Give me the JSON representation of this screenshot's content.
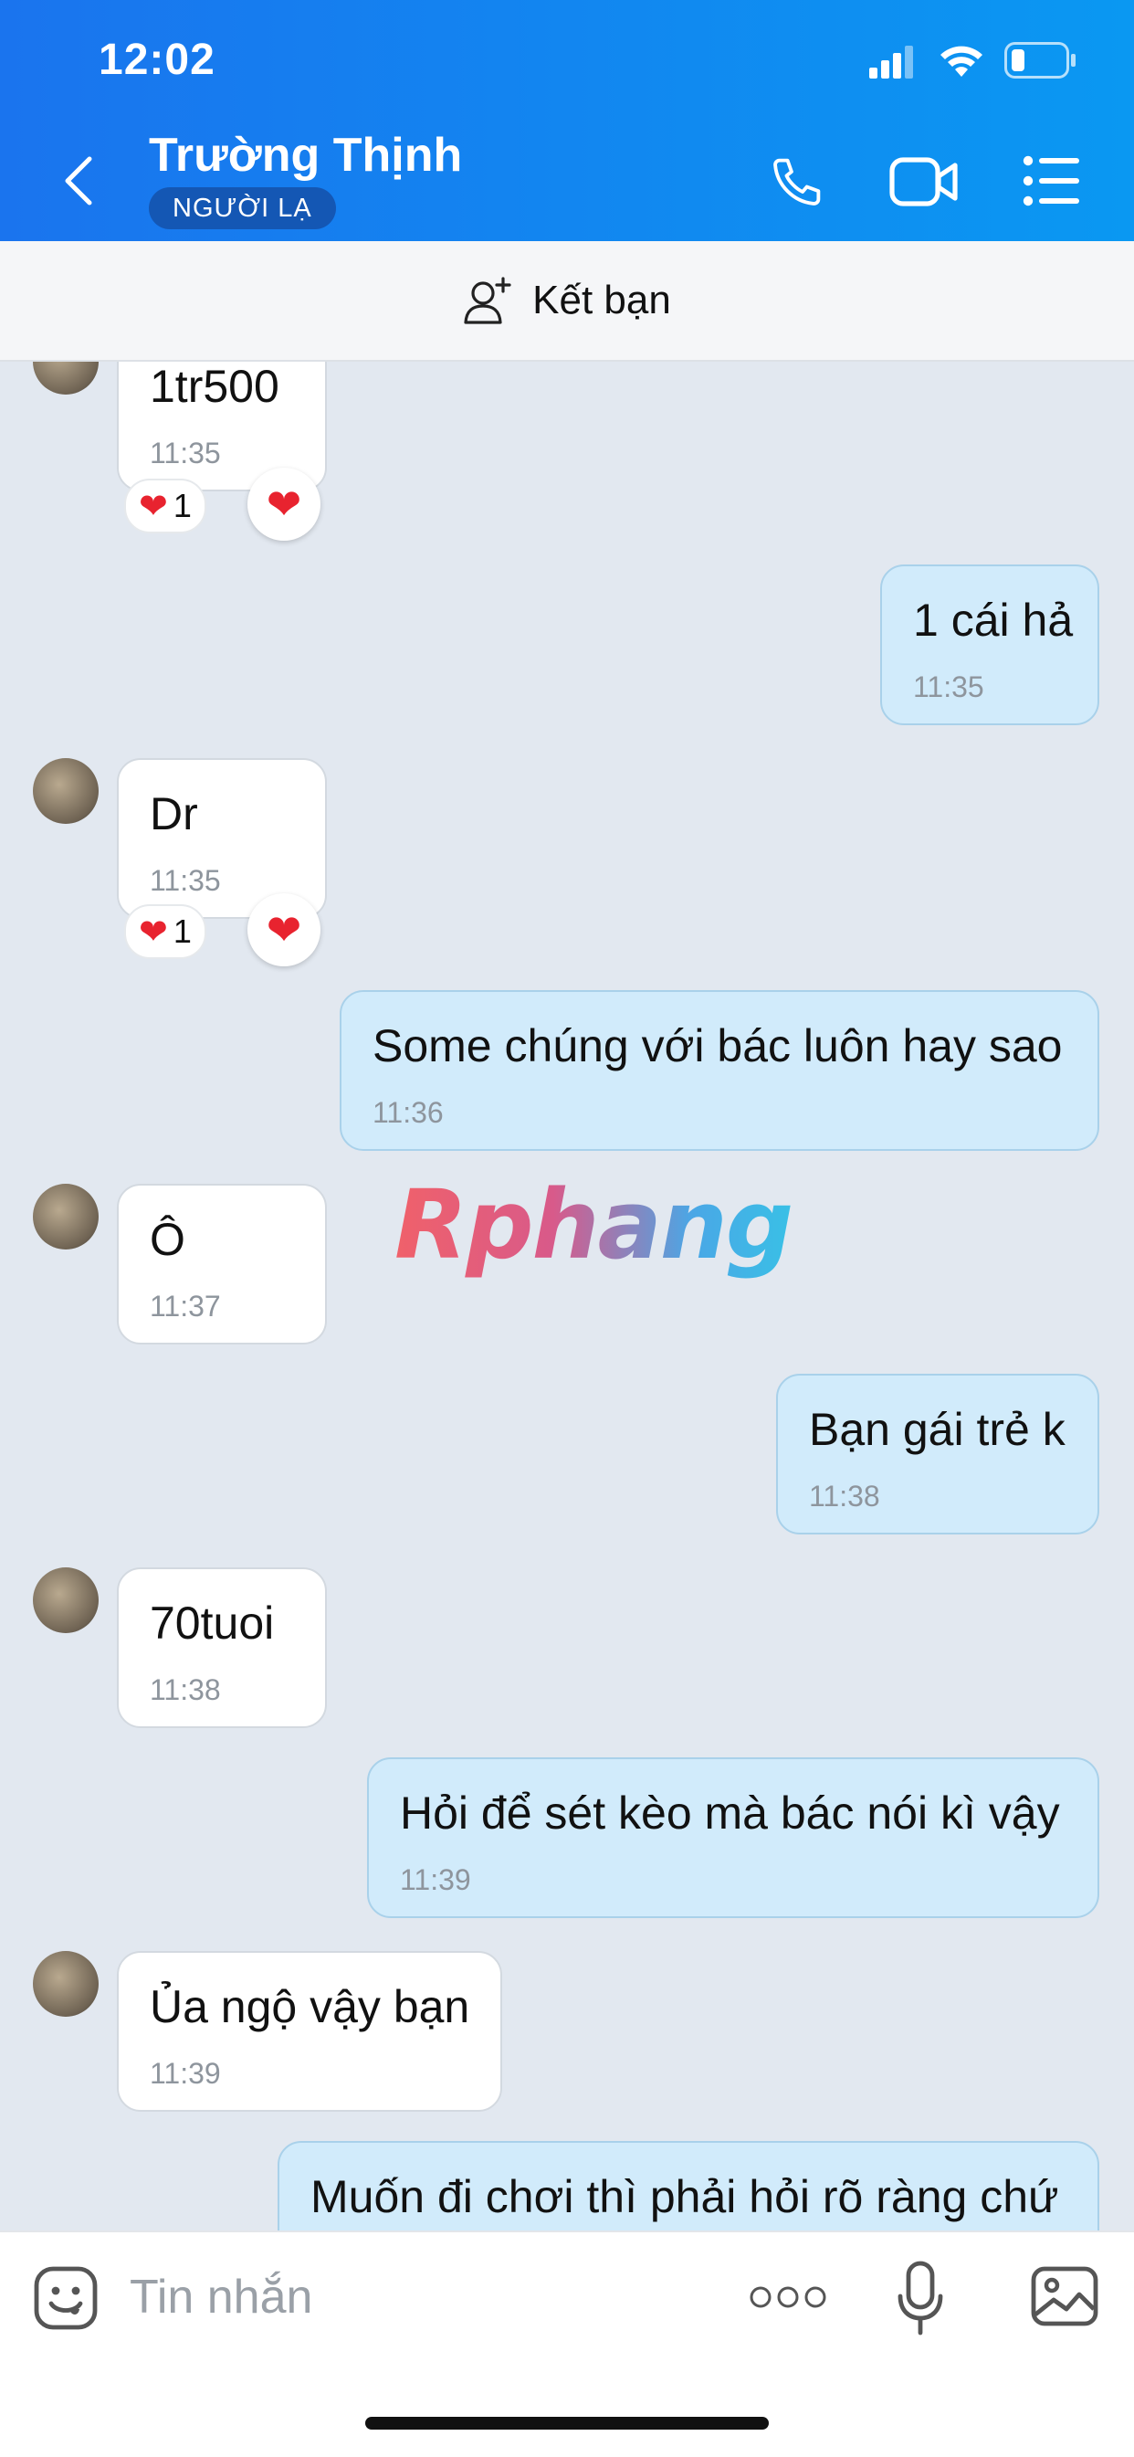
{
  "status_bar": {
    "time": "12:02"
  },
  "header": {
    "title": "Trường Thịnh",
    "badge": "NGƯỜI LẠ"
  },
  "add_friend": {
    "label": "Kết bạn"
  },
  "messages": [
    {
      "side": "in",
      "text": "1tr500",
      "time": "11:35",
      "reaction_count": "1"
    },
    {
      "side": "out",
      "text": "1 cái hả",
      "time": "11:35"
    },
    {
      "side": "in",
      "text": "Dr",
      "time": "11:35",
      "reaction_count": "1"
    },
    {
      "side": "out",
      "text": "Some chúng với bác luôn hay sao",
      "time": "11:36"
    },
    {
      "side": "in",
      "text": "Ô",
      "time": "11:37"
    },
    {
      "side": "out",
      "text": "Bạn gái trẻ k",
      "time": "11:38"
    },
    {
      "side": "in",
      "text": "70tuoi",
      "time": "11:38"
    },
    {
      "side": "out",
      "text": "Hỏi để sét kèo mà bác nói kì vậy",
      "time": "11:39"
    },
    {
      "side": "in",
      "text": "Ủa ngộ vậy bạn",
      "time": "11:39"
    },
    {
      "side": "out",
      "text": "Muốn đi chơi thì phải hỏi rõ ràng chứ",
      "time": ""
    }
  ],
  "watermark": "Rphang",
  "input": {
    "placeholder": "Tin nhắn"
  },
  "colors": {
    "header_start": "#1a74ee",
    "header_end": "#0a98f2",
    "outgoing_bubble": "#d1ebfb",
    "incoming_bubble": "#ffffff",
    "chat_background": "#e2e8f0"
  },
  "icons": [
    "back-icon",
    "phone-icon",
    "video-call-icon",
    "menu-list-icon",
    "add-friend-icon",
    "emoji-icon",
    "more-icon",
    "microphone-icon",
    "image-icon",
    "heart-icon",
    "signal-icon",
    "wifi-icon",
    "battery-icon"
  ]
}
